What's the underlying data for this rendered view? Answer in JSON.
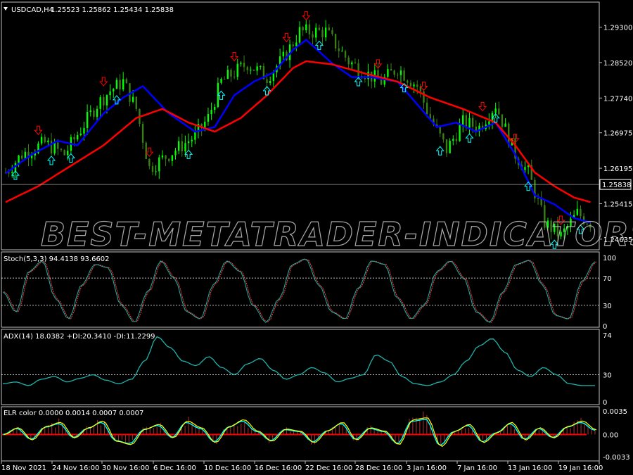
{
  "window": {
    "title": "USDCAD,H4",
    "ohlc": "1.25523 1.25862 1.25434 1.25838",
    "watermark": "BEST-METATRADER-INDICATORS.COM",
    "menu_icon": "triangle-down-icon"
  },
  "colors": {
    "background": "#000000",
    "frame": "#c0c0c0",
    "bull_candle": "#00ff00",
    "bear_candle": "#3a7f16",
    "fast_ma": "#0000ff",
    "slow_ma": "#ff0000",
    "arrow_up": "#00ffff",
    "arrow_down": "#ff0000",
    "oscillator": "#20b2aa",
    "signal": "#ff4040",
    "elr_zero": "#ff0000",
    "elr_line_1": "#ffff00",
    "elr_line_2": "#00ffff"
  },
  "panels": {
    "price": {
      "current_price": "1.25838",
      "ticks": [
        "1.29300",
        "1.28520",
        "1.27740",
        "1.26975",
        "1.26195",
        "1.25415",
        "1.24635"
      ]
    },
    "stoch": {
      "label": "Stoch(5,3,3) 94.4138 93.6602",
      "ticks": [
        "100",
        "70",
        "30",
        "0"
      ]
    },
    "adx": {
      "label": "ADX(14) 18.0382 +DI:20.3410 -DI:11.2299",
      "ticks": [
        "74",
        "30",
        "0"
      ]
    },
    "elr": {
      "label": "ELR color 0.0000 0.0014 0.0007 0.0007",
      "ticks": [
        "0.0035",
        "0.00",
        "-0.0033"
      ]
    }
  },
  "time_axis": [
    "18 Nov 2021",
    "24 Nov 16:00",
    "30 Nov 16:00",
    "6 Dec 16:00",
    "10 Dec 16:00",
    "16 Dec 16:00",
    "22 Dec 16:00",
    "28 Dec 16:00",
    "3 Jan 16:00",
    "7 Jan 16:00",
    "13 Jan 16:00",
    "19 Jan 16:00"
  ],
  "chart_data": [
    {
      "type": "line",
      "title": "USDCAD,H4",
      "chart_type_detail": "candlestick with moving averages and signal arrows",
      "ylim": [
        1.244,
        1.2985
      ],
      "grid": false,
      "close_path_x": [
        0,
        5,
        12,
        18,
        28,
        32,
        36,
        40,
        44,
        50,
        58,
        62,
        66,
        74,
        80,
        85,
        90,
        98,
        105,
        110,
        115,
        120,
        126,
        130,
        135,
        140,
        145,
        150,
        156,
        160,
        165,
        170,
        175,
        179
      ],
      "close_path_y": [
        1.261,
        1.265,
        1.2675,
        1.265,
        1.276,
        1.279,
        1.281,
        1.275,
        1.262,
        1.265,
        1.269,
        1.273,
        1.281,
        1.285,
        1.282,
        1.286,
        1.292,
        1.292,
        1.2855,
        1.283,
        1.281,
        1.284,
        1.28,
        1.273,
        1.266,
        1.272,
        1.271,
        1.276,
        1.265,
        1.261,
        1.25,
        1.247,
        1.252,
        1.25
      ],
      "series": [
        {
          "name": "",
          "color": "#0000ff",
          "x": [
            0,
            8,
            16,
            22,
            30,
            36,
            42,
            50,
            58,
            64,
            70,
            76,
            82,
            88,
            92,
            100,
            106,
            112,
            120,
            126,
            132,
            138,
            144,
            150,
            156,
            162,
            168,
            174,
            179
          ],
          "values": [
            1.2608,
            1.265,
            1.268,
            1.267,
            1.274,
            1.2775,
            1.28,
            1.274,
            1.27,
            1.271,
            1.278,
            1.281,
            1.283,
            1.288,
            1.2902,
            1.285,
            1.282,
            1.282,
            1.281,
            1.276,
            1.271,
            1.272,
            1.27,
            1.272,
            1.265,
            1.256,
            1.254,
            1.251,
            1.25
          ]
        },
        {
          "name": "",
          "color": "#ff0000",
          "x": [
            0,
            10,
            20,
            30,
            40,
            48,
            56,
            64,
            72,
            80,
            88,
            92,
            100,
            110,
            120,
            130,
            140,
            150,
            156,
            162,
            168,
            174,
            179
          ],
          "values": [
            1.2545,
            1.258,
            1.2625,
            1.267,
            1.273,
            1.275,
            1.272,
            1.27,
            1.273,
            1.278,
            1.284,
            1.2855,
            1.2848,
            1.2828,
            1.281,
            1.2775,
            1.275,
            1.272,
            1.267,
            1.261,
            1.258,
            1.2555,
            1.2545
          ]
        }
      ]
    },
    {
      "type": "line",
      "title": "Stoch(5,3,3)",
      "ylim": [
        0,
        100
      ],
      "grid": true,
      "levels": [
        70,
        30
      ],
      "series": [
        {
          "name": "",
          "values": [
            50,
            20,
            80,
            95,
            40,
            10,
            60,
            90,
            85,
            30,
            5,
            50,
            95,
            70,
            20,
            10,
            60,
            95,
            80,
            30,
            5,
            40,
            90,
            98,
            60,
            20,
            10,
            55,
            95,
            90,
            40,
            10,
            30,
            80,
            95,
            70,
            20,
            5,
            50,
            90,
            96,
            60,
            15,
            10,
            65,
            94
          ]
        }
      ]
    },
    {
      "type": "line",
      "title": "ADX(14)",
      "ylim": [
        0,
        74
      ],
      "grid": true,
      "levels": [
        30
      ],
      "series": [
        {
          "name": "",
          "values": [
            20,
            22,
            18,
            25,
            28,
            22,
            26,
            30,
            24,
            20,
            25,
            45,
            72,
            60,
            45,
            40,
            50,
            38,
            30,
            42,
            48,
            35,
            25,
            30,
            38,
            32,
            22,
            26,
            30,
            52,
            45,
            28,
            20,
            18,
            22,
            30,
            45,
            62,
            70,
            55,
            35,
            28,
            38,
            30,
            20,
            18,
            18
          ]
        }
      ]
    },
    {
      "type": "line",
      "title": "ELR color",
      "ylim": [
        -0.0033,
        0.0035
      ],
      "grid": false,
      "series": [
        {
          "name": "",
          "values": [
            0.0,
            0.001,
            -0.0008,
            0.0012,
            0.0018,
            -0.0005,
            0.001,
            0.002,
            -0.001,
            -0.0015,
            0.0008,
            0.0015,
            -0.0005,
            0.002,
            0.001,
            -0.0012,
            0.0012,
            0.0022,
            0.0005,
            -0.001,
            0.0008,
            0.0005,
            -0.0012,
            0.0006,
            0.0018,
            -0.0008,
            0.001,
            0.0005,
            -0.0015,
            0.0022,
            0.0025,
            -0.0018,
            0.0005,
            0.0015,
            -0.0012,
            0.0003,
            0.0018,
            -0.0008,
            0.001,
            -0.0005,
            0.0012,
            0.002,
            0.0007
          ]
        }
      ]
    }
  ]
}
